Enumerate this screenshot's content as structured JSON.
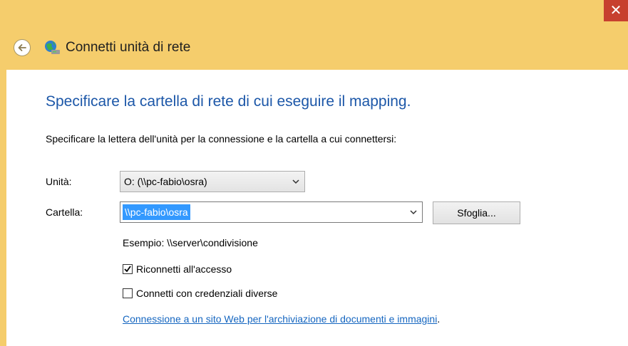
{
  "window": {
    "title": "Connetti unità di rete",
    "close_glyph": "✕",
    "frame_color": "#f5cd6c",
    "close_color": "#c7402f",
    "back_icon": "back-arrow-icon",
    "app_icon": "network-drive-icon"
  },
  "main": {
    "heading": "Specificare la cartella di rete di cui eseguire il mapping.",
    "heading_color": "#1c57a8",
    "instruction": "Specificare la lettera dell'unità per la connessione e la cartella a cui connettersi:"
  },
  "form": {
    "unit_label": "Unità:",
    "unit_value": "O: (\\\\pc-fabio\\osra)",
    "folder_label": "Cartella:",
    "folder_value": "\\\\pc-fabio\\osra",
    "browse_label": "Sfoglia...",
    "example": "Esempio: \\\\server\\condivisione",
    "reconnect_label": "Riconnetti all'accesso",
    "reconnect_checked": true,
    "credentials_label": "Connetti con credenziali diverse",
    "credentials_checked": false,
    "link_text": "Connessione a un sito Web per l'archiviazione di documenti e immagini",
    "link_suffix": ".",
    "link_color": "#1566c0",
    "selection_color": "#3399ff"
  }
}
